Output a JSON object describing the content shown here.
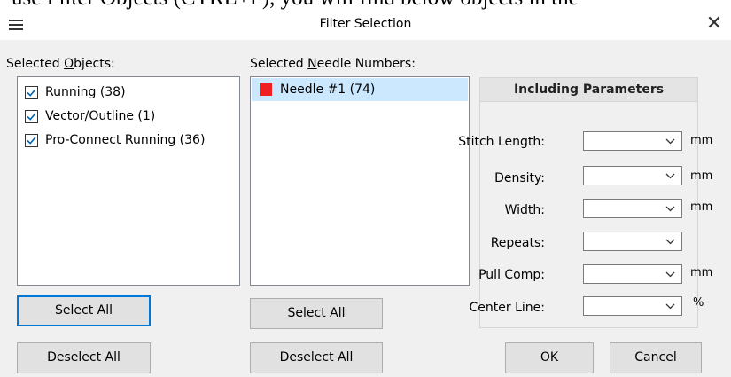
{
  "background_text": "use Filter Objects (CTRL+F), you will find below objects in the",
  "dialog": {
    "title": "Filter Selection",
    "close_glyph": "✕"
  },
  "objects": {
    "label": "Selected Objects:",
    "items": [
      {
        "label": "Running (38)",
        "checked": true
      },
      {
        "label": "Vector/Outline (1)",
        "checked": true
      },
      {
        "label": "Pro-Connect Running (36)",
        "checked": true
      }
    ],
    "select_all": "Select All",
    "deselect_all": "Deselect All"
  },
  "needles": {
    "label": "Selected Needle Numbers:",
    "items": [
      {
        "label": "Needle #1 (74)",
        "color": "#f02020",
        "selected": true
      }
    ],
    "select_all": "Select All",
    "deselect_all": "Deselect All"
  },
  "params": {
    "header": "Including Parameters",
    "fields": [
      {
        "label": "Stitch Length:",
        "value": "",
        "unit": "mm"
      },
      {
        "label": "Density:",
        "value": "",
        "unit": "mm"
      },
      {
        "label": "Width:",
        "value": "",
        "unit": "mm"
      },
      {
        "label": "Repeats:",
        "value": "",
        "unit": ""
      },
      {
        "label": "Pull Comp:",
        "value": "",
        "unit": "mm"
      },
      {
        "label": "Center Line:",
        "value": "",
        "unit": "%"
      }
    ]
  },
  "buttons": {
    "ok": "OK",
    "cancel": "Cancel"
  },
  "colors": {
    "accent": "#0078d7",
    "selection": "#cce8ff",
    "dialog_bg": "#f0f0f0"
  }
}
